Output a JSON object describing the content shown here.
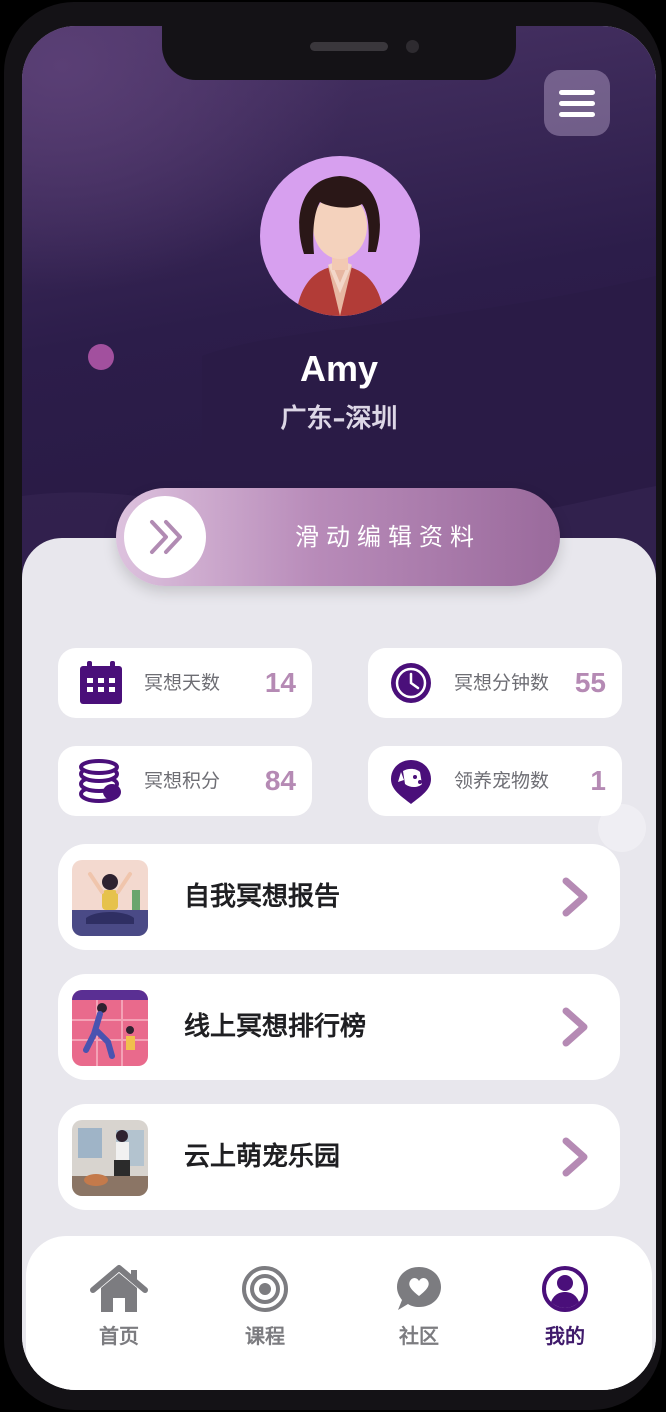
{
  "header": {
    "menu_icon": "hamburger-menu-icon"
  },
  "profile": {
    "name": "Amy",
    "location": "广东–深圳",
    "avatar": "avatar-illustration"
  },
  "slider": {
    "label": "滑动编辑资料",
    "icon": "double-chevron-right-icon"
  },
  "stats": [
    {
      "label": "冥想天数",
      "value": "14",
      "icon": "calendar-icon"
    },
    {
      "label": "冥想分钟数",
      "value": "55",
      "icon": "clock-icon"
    },
    {
      "label": "冥想积分",
      "value": "84",
      "icon": "coins-icon"
    },
    {
      "label": "领养宠物数",
      "value": "1",
      "icon": "pet-dog-icon"
    }
  ],
  "menu": [
    {
      "title": "自我冥想报告",
      "thumb": "yoga-thumbnail"
    },
    {
      "title": "线上冥想排行榜",
      "thumb": "running-thumbnail"
    },
    {
      "title": "云上萌宠乐园",
      "thumb": "pet-room-thumbnail"
    }
  ],
  "tabs": [
    {
      "label": "首页",
      "icon": "home-icon",
      "active": false
    },
    {
      "label": "课程",
      "icon": "target-icon",
      "active": false
    },
    {
      "label": "社区",
      "icon": "chat-heart-icon",
      "active": false
    },
    {
      "label": "我的",
      "icon": "user-icon",
      "active": true
    }
  ],
  "colors": {
    "hero_dark": "#2c1d4a",
    "accent_purple": "#4a0f7a",
    "stat_value": "#b58ab4",
    "slider_light": "#ddc2de",
    "slider_dark": "#9a6a9c"
  }
}
